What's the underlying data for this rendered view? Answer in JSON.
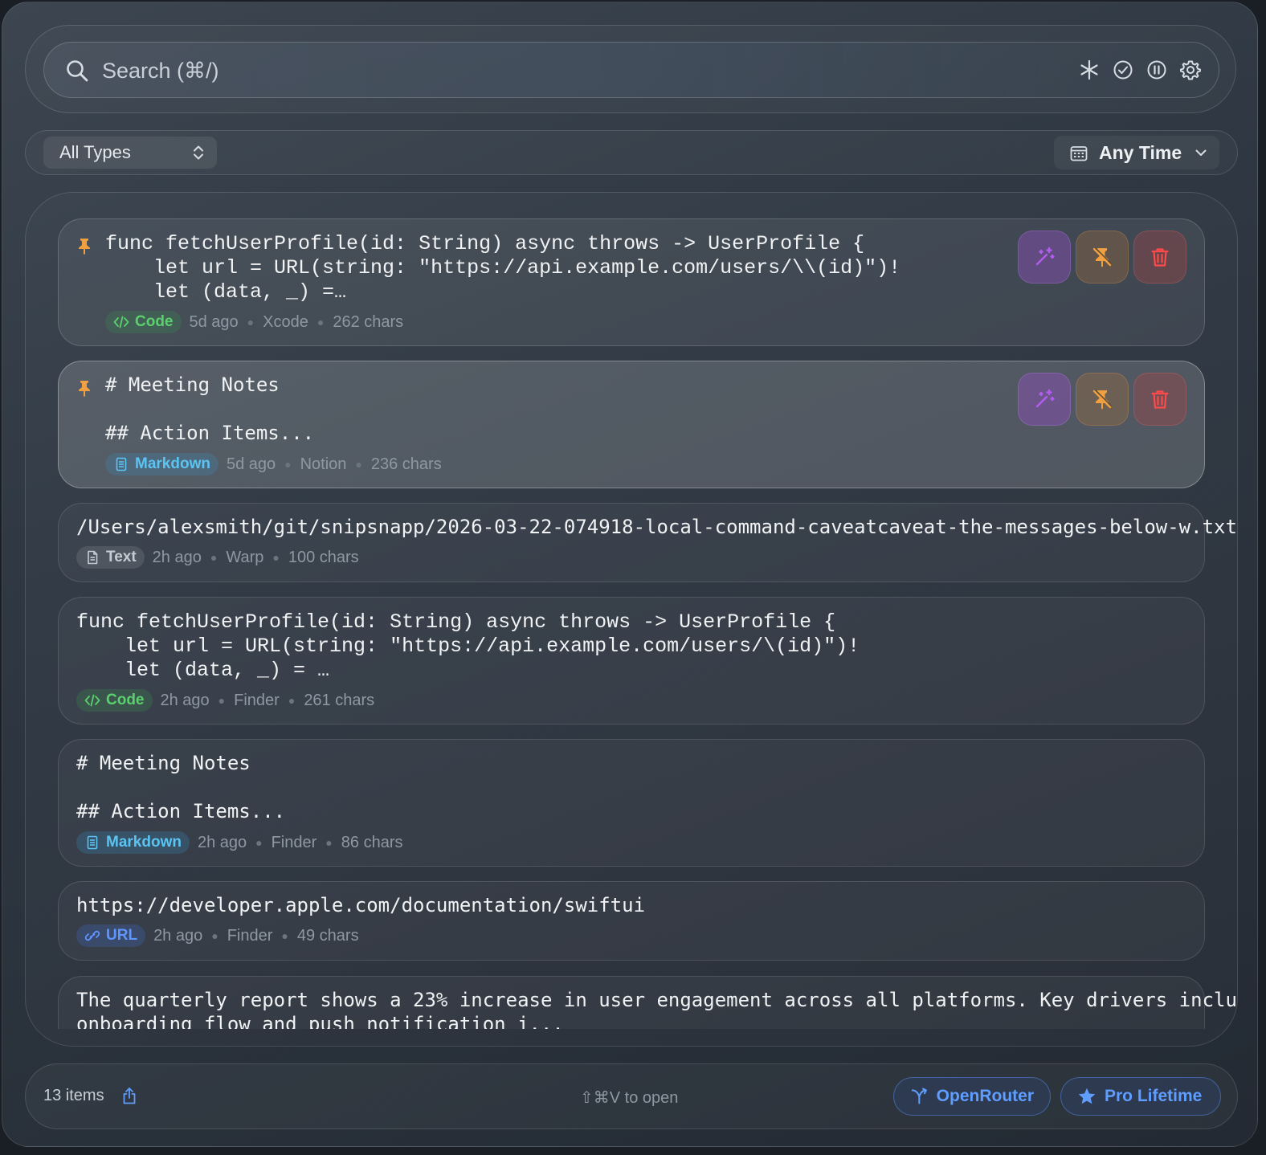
{
  "search": {
    "placeholder": "Search (⌘/)",
    "value": ""
  },
  "toolbar": {
    "icons": [
      "asterisk-icon",
      "check-circle-icon",
      "pause-circle-icon",
      "gear-icon"
    ]
  },
  "filters": {
    "type_label": "All Types",
    "time_label": "Any Time"
  },
  "items": [
    {
      "pinned": true,
      "kind": "code",
      "content": "func fetchUserProfile(id: String) async throws -> UserProfile {\n    let url = URL(string: \"https://api.example.com/users/\\\\(id)\")!\n    let (data, _) =…",
      "badge": "Code",
      "time": "5d ago",
      "source": "Xcode",
      "chars": "262 chars"
    },
    {
      "pinned": true,
      "selected": true,
      "kind": "markdown",
      "content": "# Meeting Notes\n\n## Action Items...",
      "badge": "Markdown",
      "time": "5d ago",
      "source": "Notion",
      "chars": "236 chars"
    },
    {
      "kind": "text",
      "content": "/Users/alexsmith/git/snipsnapp/2026-03-22-074918-local-command-caveatcaveat-the-messages-below-w.txt",
      "badge": "Text",
      "time": "2h ago",
      "source": "Warp",
      "chars": "100 chars"
    },
    {
      "kind": "code",
      "content": "func fetchUserProfile(id: String) async throws -> UserProfile {\n    let url = URL(string: \"https://api.example.com/users/\\(id)\")!\n    let (data, _) = …",
      "badge": "Code",
      "time": "2h ago",
      "source": "Finder",
      "chars": "261 chars"
    },
    {
      "kind": "markdown",
      "content": "# Meeting Notes\n\n## Action Items...",
      "badge": "Markdown",
      "time": "2h ago",
      "source": "Finder",
      "chars": "86 chars"
    },
    {
      "kind": "url",
      "content": "https://developer.apple.com/documentation/swiftui",
      "badge": "URL",
      "time": "2h ago",
      "source": "Finder",
      "chars": "49 chars"
    },
    {
      "kind": "text",
      "content": "The quarterly report shows a 23% increase in user engagement across all platforms. Key drivers include the new\nonboarding flow and push notification i..."
    }
  ],
  "footer": {
    "count": "13 items",
    "hint": "⇧⌘V to open",
    "openrouter_label": "OpenRouter",
    "pro_label": "Pro Lifetime"
  },
  "colors": {
    "code": "#5ccf6e",
    "markdown": "#5cc4f2",
    "url": "#5f95ff",
    "pin": "#f0a040",
    "accent": "#5f9dff"
  }
}
